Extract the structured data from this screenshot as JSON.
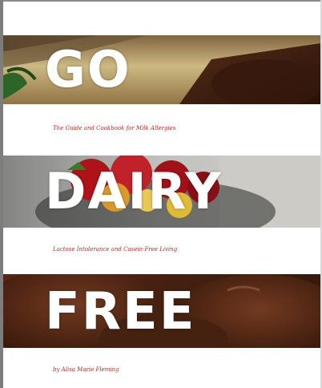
{
  "cover": {
    "title_lines": [
      "GO",
      "DAIRY",
      "FREE"
    ],
    "subtitle_1": "The Guide and Cookbook for Milk Allergies",
    "subtitle_2": "Lactose Intolerance and Casein-Free Living",
    "author_line": "by Alisa Marie Fleming"
  },
  "colors": {
    "title_text": "#ffffff",
    "subtitle_text": "#b32a20",
    "background": "#ffffff"
  }
}
